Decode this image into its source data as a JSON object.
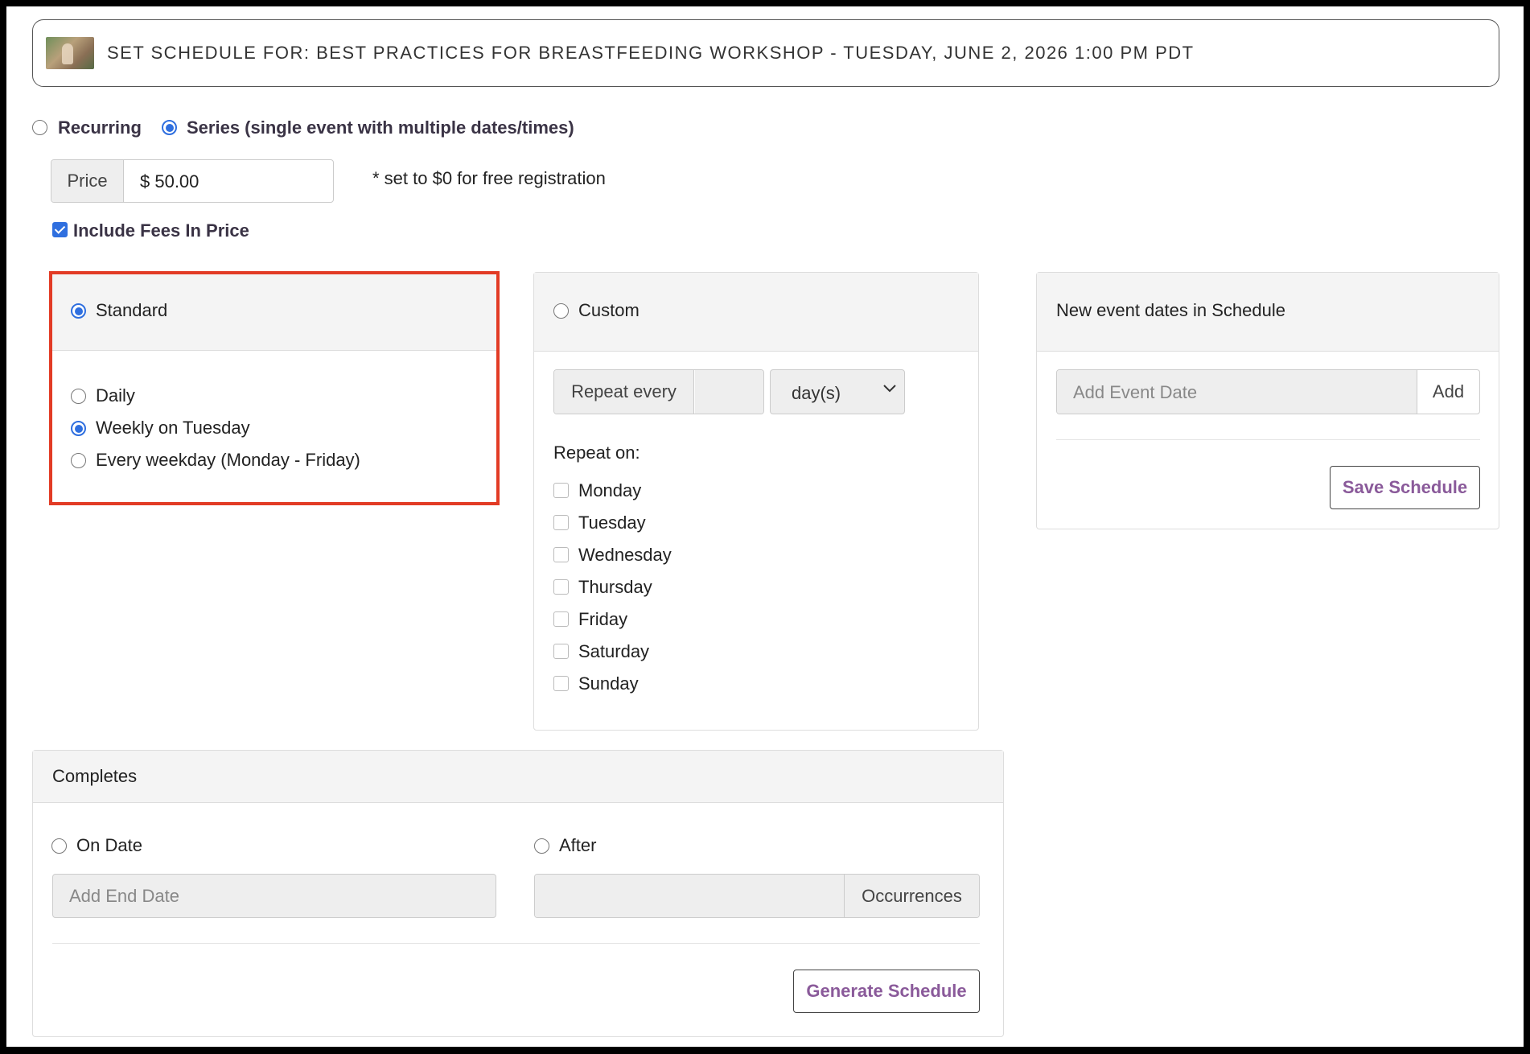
{
  "header": {
    "title": "SET SCHEDULE FOR: BEST PRACTICES FOR BREASTFEEDING WORKSHOP - TUESDAY, JUNE 2, 2026 1:00 PM PDT"
  },
  "mode": {
    "recurring_label": "Recurring",
    "series_label": "Series (single event with multiple dates/times)",
    "selected": "series"
  },
  "price": {
    "addon_label": "Price",
    "value": "$ 50.00",
    "note": "* set to $0 for free registration",
    "include_fees_label": "Include Fees In Price",
    "include_fees_checked": true
  },
  "standard": {
    "title": "Standard",
    "selected": true,
    "options": [
      {
        "label": "Daily",
        "selected": false
      },
      {
        "label": "Weekly on Tuesday",
        "selected": true
      },
      {
        "label": "Every weekday (Monday - Friday)",
        "selected": false
      }
    ]
  },
  "custom": {
    "title": "Custom",
    "selected": false,
    "repeat_every_label": "Repeat every",
    "repeat_every_value": "",
    "unit_value": "day(s)",
    "repeat_on_label": "Repeat on:",
    "days": [
      "Monday",
      "Tuesday",
      "Wednesday",
      "Thursday",
      "Friday",
      "Saturday",
      "Sunday"
    ]
  },
  "new_dates": {
    "title": "New event dates in Schedule",
    "add_placeholder": "Add Event Date",
    "add_button": "Add",
    "save_button": "Save Schedule"
  },
  "completes": {
    "title": "Completes",
    "on_date_label": "On Date",
    "end_date_placeholder": "Add End Date",
    "after_label": "After",
    "occurrences_label": "Occurrences",
    "generate_button": "Generate Schedule"
  },
  "highlight_color": "#e23b25",
  "accent_color": "#2f6fdf"
}
